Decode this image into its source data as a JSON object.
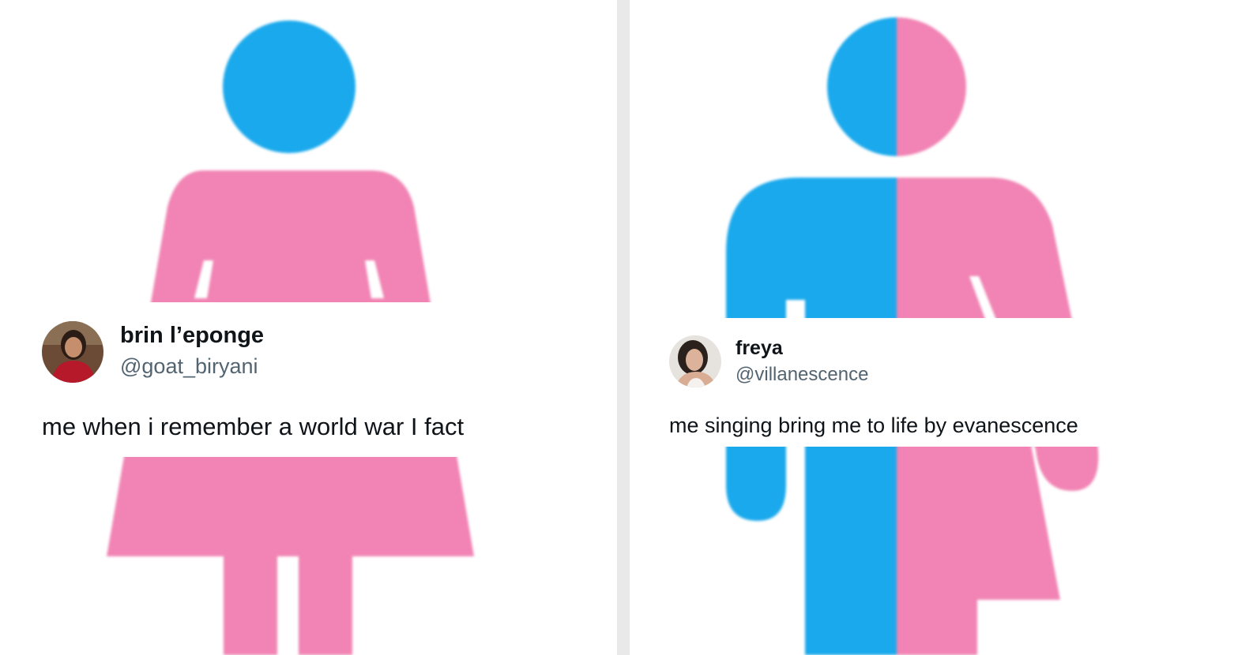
{
  "colors": {
    "figure_blue": "#1aa9ec",
    "figure_pink": "#f184b4",
    "name_text": "#0f1419",
    "handle_text": "#536471",
    "divider": "#e9e9e9"
  },
  "left_tweet": {
    "display_name": "brin l’eponge",
    "handle": "@goat_biryani",
    "text": "me when i remember a world war I fact",
    "avatar_icon": "user-avatar-red-shirt",
    "background_icon": "female-restroom-icon"
  },
  "right_tweet": {
    "display_name": "freya",
    "handle": "@villanescence",
    "text": "me singing bring me to life by evanescence",
    "avatar_icon": "user-avatar-dark-hair",
    "background_icon": "half-male-half-female-restroom-icon"
  }
}
